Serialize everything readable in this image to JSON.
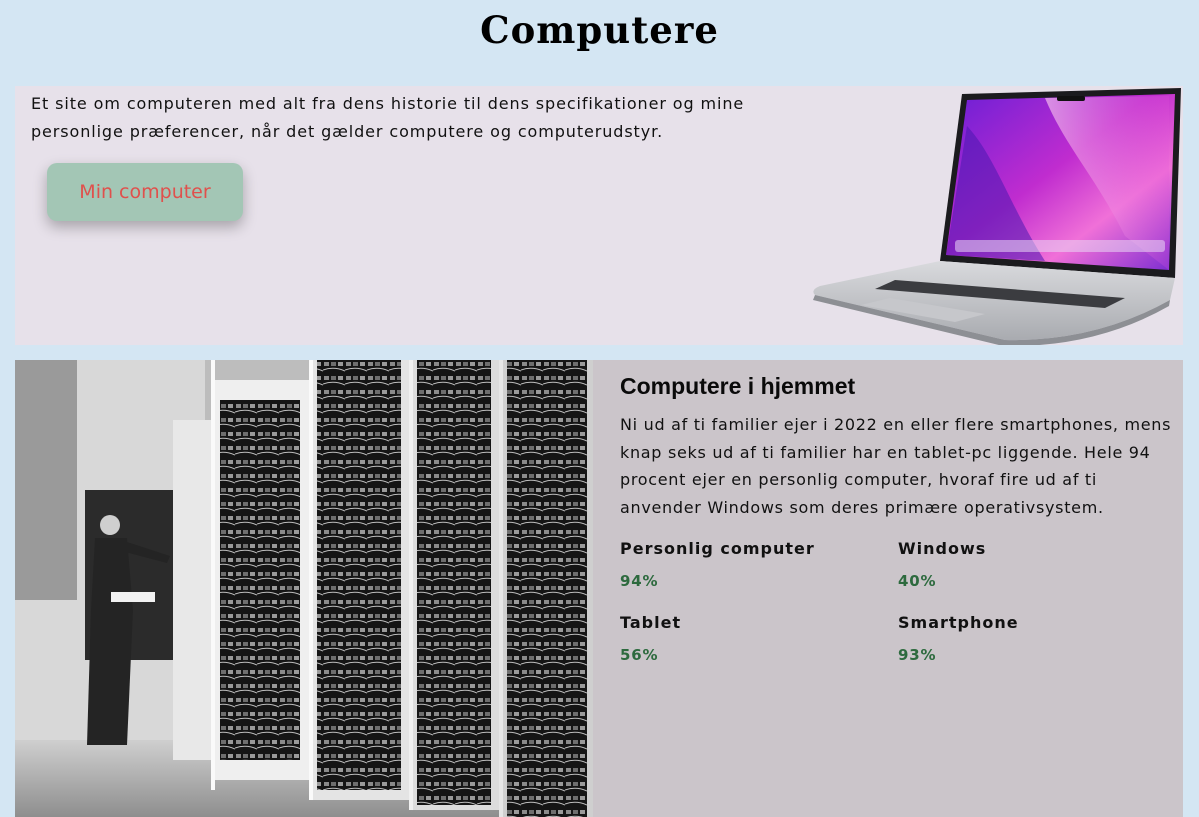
{
  "header": {
    "title": "Computere"
  },
  "hero": {
    "text": "Et site om computeren med alt fra dens historie til dens specifikationer og mine personlige præferencer, når det gælder computere og computerudstyr.",
    "button_label": "Min computer",
    "image_icon": "laptop-image",
    "colors": {
      "background": "#e7e1ea",
      "button_bg": "#a3c6b5",
      "button_text": "#e0504c"
    }
  },
  "section": {
    "image_icon": "mainframe-photo",
    "title": "Computere i hjemmet",
    "text": "Ni ud af ti familier ejer i 2022 en eller flere smartphones, mens knap seks ud af ti familier har en tablet-pc liggende. Hele 94 procent ejer en personlig computer, hvoraf fire ud af ti anvender Windows som deres primære operativsystem.",
    "stats": [
      {
        "label": "Personlig computer",
        "value": "94%"
      },
      {
        "label": "Windows",
        "value": "40%"
      },
      {
        "label": "Tablet",
        "value": "56%"
      },
      {
        "label": "Smartphone",
        "value": "93%"
      }
    ],
    "colors": {
      "background": "#cbc5ca",
      "stat_value": "#2d6a3e"
    }
  },
  "colors": {
    "page_background": "#d4e6f3"
  }
}
